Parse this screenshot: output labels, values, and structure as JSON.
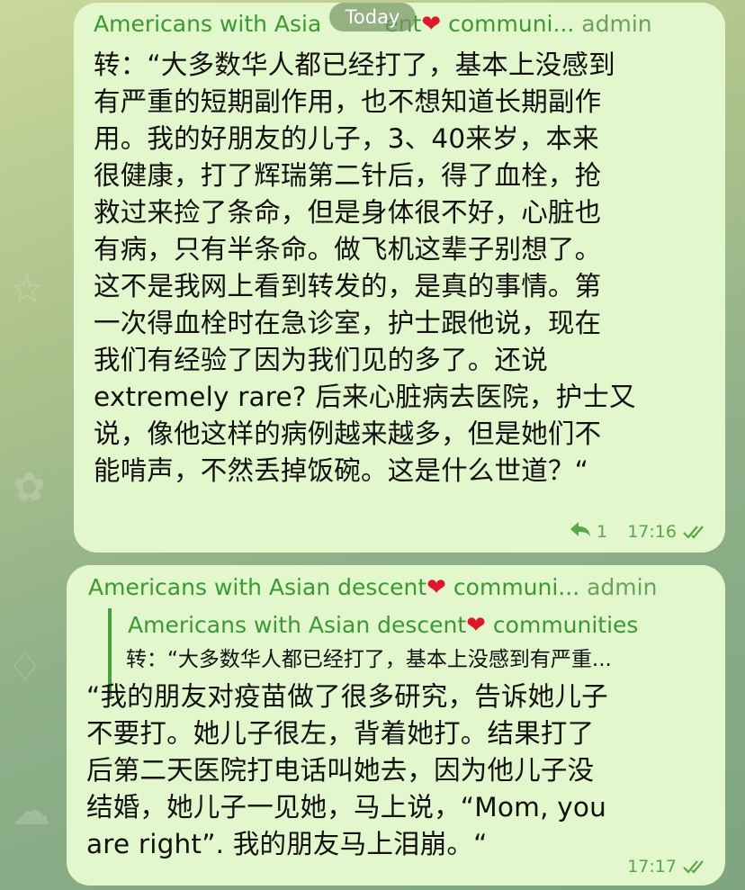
{
  "date_divider": "Today",
  "colors": {
    "bubble": "#e2f7cb",
    "sender": "#3a9a32",
    "meta": "#5aa54e",
    "heart": "#e0162b",
    "pill": "#7a9664"
  },
  "messages": [
    {
      "sender_name_a": "Americans with Asia",
      "sender_name_b": "ent",
      "heart": "❤",
      "sender_tail": "communi...",
      "role": "admin",
      "lines": [
        "转：“大多数华人都已经打了，基本上没感到",
        "有严重的短期副作用，也不想知道长期副作",
        "用。我的好朋友的儿子，3、40来岁，本来",
        "很健康，打了辉瑞第二针后，得了血栓，抢",
        "救过来捡了条命，但是身体很不好，心脏也",
        "有病，只有半条命。做飞机这辈子别想了。",
        "这不是我网上看到转发的，是真的事情。第",
        "一次得血栓时在急诊室，护士跟他说，现在",
        "我们有经验了因为我们见的多了。还说",
        "extremely rare? 后来心脏病去医院，护士又",
        "说，像他这样的病例越来越多，但是她们不",
        "能啃声，不然丢掉饭碗。这是什么世道？“"
      ],
      "reply_icon": "reply-arrow-icon",
      "reply_count": "1",
      "time": "17:16",
      "status_icon": "double-check-icon"
    },
    {
      "sender_name": "Americans with Asian descent",
      "heart": "❤",
      "sender_tail": "communi...",
      "role": "admin",
      "quote": {
        "name": "Americans with Asian descent",
        "heart": "❤",
        "name_tail": "communities",
        "text": "转：“大多数华人都已经打了，基本上没感到有严重..."
      },
      "lines": [
        "“我的朋友对疫苗做了很多研究，告诉她儿子",
        "不要打。她儿子很左，背着她打。结果打了",
        "后第二天医院打电话叫她去，因为他儿子没",
        "结婚，她儿子一见她，马上说，“Mom, you",
        "are right”. 我的朋友马上泪崩。“"
      ],
      "time": "17:17",
      "status_icon": "double-check-icon"
    }
  ]
}
